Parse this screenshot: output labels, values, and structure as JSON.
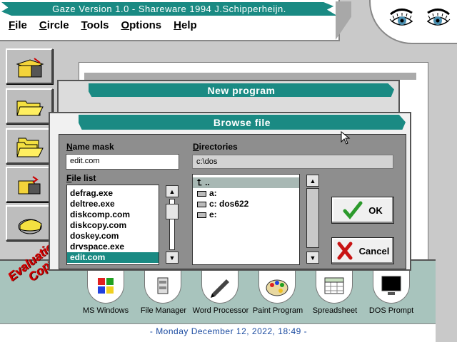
{
  "app": {
    "title": "Gaze Version 1.0 - Shareware 1994 J.Schipperheijn."
  },
  "menu": [
    {
      "first": "F",
      "rest": "ile"
    },
    {
      "first": "C",
      "rest": "ircle"
    },
    {
      "first": "T",
      "rest": "ools"
    },
    {
      "first": "O",
      "rest": "ptions"
    },
    {
      "first": "H",
      "rest": "elp"
    }
  ],
  "new_program": {
    "title": "New program"
  },
  "browse": {
    "title": "Browse file",
    "name_mask_label_first": "N",
    "name_mask_label_rest": "ame mask",
    "name_mask_value": "edit.com",
    "directories_label_first": "D",
    "directories_label_rest": "irectories",
    "current_dir": "c:\\dos",
    "file_list_label_first": "F",
    "file_list_label_rest": "ile list",
    "files": [
      "defrag.exe",
      "deltree.exe",
      "diskcomp.com",
      "diskcopy.com",
      "doskey.com",
      "drvspace.exe",
      "edit.com"
    ],
    "selected_file": "edit.com",
    "dirs": [
      {
        "label": "..",
        "kind": "up"
      },
      {
        "label": "a:",
        "kind": "drive"
      },
      {
        "label": "c:  dos622",
        "kind": "drive"
      },
      {
        "label": "e:",
        "kind": "drive"
      }
    ],
    "ok_label": "OK",
    "cancel_label": "Cancel"
  },
  "taskbar": {
    "items": [
      "MS Windows",
      "File Manager",
      "Word Processor",
      "Paint Program",
      "Spreadsheet",
      "DOS Prompt"
    ]
  },
  "watermark": {
    "line1": "Evaluation",
    "line2": "Copy"
  },
  "status": {
    "datetime": "- Monday December 12, 2022, 18:49 -"
  },
  "colors": {
    "accent": "#1a8a83",
    "ok_check": "#2c9a2c",
    "cancel_x": "#c81414",
    "watermark": "#d40000"
  }
}
